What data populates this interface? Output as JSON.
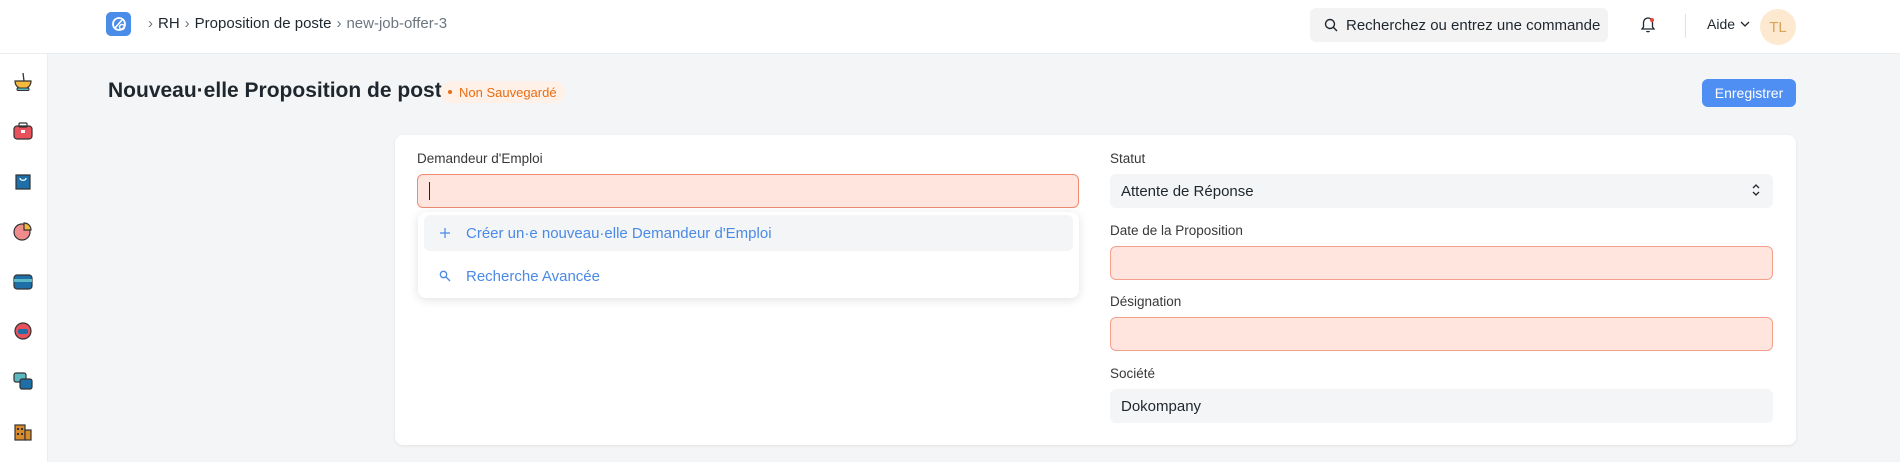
{
  "breadcrumb": {
    "items": [
      "RH",
      "Proposition de poste",
      "new-job-offer-3"
    ]
  },
  "search": {
    "placeholder": "Recherchez ou entrez une commande"
  },
  "header": {
    "help_label": "Aide",
    "avatar_initials": "TL"
  },
  "sidebar": {
    "icons": [
      "bowl-icon",
      "briefcase-icon",
      "shopping-bag-icon",
      "pie-chart-icon",
      "wallet-icon",
      "support-icon",
      "chat-icon",
      "building-icon"
    ]
  },
  "page": {
    "title": "Nouveau·elle Proposition de poste",
    "status": "Non Sauvegardé",
    "save_label": "Enregistrer"
  },
  "form": {
    "applicant_label": "Demandeur d'Emploi",
    "applicant_value": "",
    "status_label": "Statut",
    "status_value": "Attente de Réponse",
    "offer_date_label": "Date de la Proposition",
    "offer_date_value": "",
    "designation_label": "Désignation",
    "designation_value": "",
    "company_label": "Société",
    "company_value": "Dokompany"
  },
  "dropdown": {
    "create_label": "Créer un·e nouveau·elle Demandeur d'Emploi",
    "advanced_label": "Recherche Avancée"
  },
  "colors": {
    "accent": "#4f8ef2",
    "error_bg": "#ffe5de",
    "error_border": "#f4a08d",
    "unsaved": "#e86c13"
  }
}
